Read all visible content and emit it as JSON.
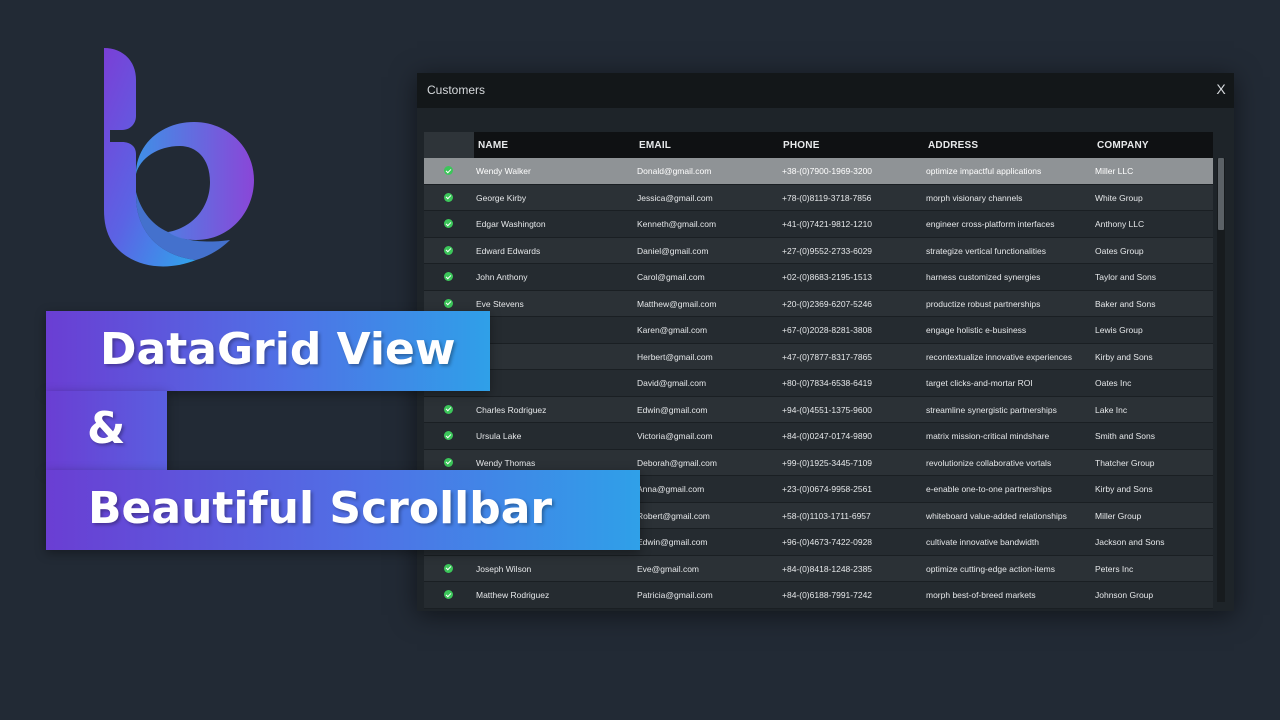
{
  "window": {
    "title": "Customers",
    "close_label": "X"
  },
  "columns": {
    "name": "NAME",
    "email": "EMAIL",
    "phone": "PHONE",
    "address": "ADDRESS",
    "company": "COMPANY"
  },
  "rows": [
    {
      "name": "Wendy Walker",
      "email": "Donald@gmail.com",
      "phone": "+38-(0)7900-1969-3200",
      "address": "optimize impactful applications",
      "company": "Miller LLC"
    },
    {
      "name": "George Kirby",
      "email": "Jessica@gmail.com",
      "phone": "+78-(0)8119-3718-7856",
      "address": "morph visionary channels",
      "company": "White Group"
    },
    {
      "name": "Edgar Washington",
      "email": "Kenneth@gmail.com",
      "phone": "+41-(0)7421-9812-1210",
      "address": "engineer cross-platform interfaces",
      "company": "Anthony LLC"
    },
    {
      "name": "Edward Edwards",
      "email": "Daniel@gmail.com",
      "phone": "+27-(0)9552-2733-6029",
      "address": "strategize vertical functionalities",
      "company": "Oates Group"
    },
    {
      "name": "John Anthony",
      "email": "Carol@gmail.com",
      "phone": "+02-(0)8683-2195-1513",
      "address": "harness customized synergies",
      "company": "Taylor and Sons"
    },
    {
      "name": "Eve Stevens",
      "email": "Matthew@gmail.com",
      "phone": "+20-(0)2369-6207-5246",
      "address": "productize robust partnerships",
      "company": "Baker and Sons"
    },
    {
      "name": "",
      "email": "Karen@gmail.com",
      "phone": "+67-(0)2028-8281-3808",
      "address": "engage holistic e-business",
      "company": "Lewis Group"
    },
    {
      "name": "",
      "email": "Herbert@gmail.com",
      "phone": "+47-(0)7877-8317-7865",
      "address": "recontextualize innovative experiences",
      "company": "Kirby and Sons"
    },
    {
      "name": "",
      "email": "David@gmail.com",
      "phone": "+80-(0)7834-6538-6419",
      "address": "target clicks-and-mortar ROI",
      "company": "Oates Inc"
    },
    {
      "name": "Charles Rodriguez",
      "email": "Edwin@gmail.com",
      "phone": "+94-(0)4551-1375-9600",
      "address": "streamline synergistic partnerships",
      "company": "Lake Inc"
    },
    {
      "name": "Ursula Lake",
      "email": "Victoria@gmail.com",
      "phone": "+84-(0)0247-0174-9890",
      "address": "matrix mission-critical mindshare",
      "company": "Smith and Sons"
    },
    {
      "name": "Wendy Thomas",
      "email": "Deborah@gmail.com",
      "phone": "+99-(0)1925-3445-7109",
      "address": "revolutionize collaborative vortals",
      "company": "Thatcher Group"
    },
    {
      "name": "",
      "email": "Anna@gmail.com",
      "phone": "+23-(0)0674-9958-2561",
      "address": "e-enable one-to-one partnerships",
      "company": "Kirby and Sons"
    },
    {
      "name": "",
      "email": "Robert@gmail.com",
      "phone": "+58-(0)1103-1711-6957",
      "address": "whiteboard value-added relationships",
      "company": "Miller Group"
    },
    {
      "name": "",
      "email": "Edwin@gmail.com",
      "phone": "+96-(0)4673-7422-0928",
      "address": "cultivate innovative bandwidth",
      "company": "Jackson and Sons"
    },
    {
      "name": "Joseph Wilson",
      "email": "Eve@gmail.com",
      "phone": "+84-(0)8418-1248-2385",
      "address": "optimize cutting-edge action-items",
      "company": "Peters Inc"
    },
    {
      "name": "Matthew Rodriguez",
      "email": "Patricia@gmail.com",
      "phone": "+84-(0)6188-7991-7242",
      "address": "morph best-of-breed markets",
      "company": "Johnson Group"
    }
  ],
  "selected_row": 0,
  "banners": {
    "line1": "DataGrid View",
    "line2": "&",
    "line3": "Beautiful Scrollbar"
  },
  "icons": {
    "logo": "b-logo-icon",
    "row_status": "check-circle-icon"
  },
  "colors": {
    "background": "#222a35",
    "check": "#3cc65a",
    "banner_start": "#6a3ed3",
    "banner_end": "#2fa0e8"
  }
}
